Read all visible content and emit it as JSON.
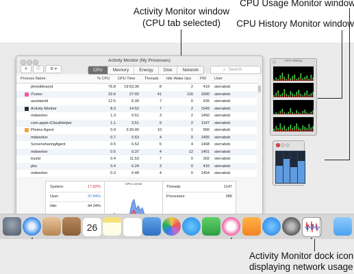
{
  "callouts": {
    "activity_window": "Activity Monitor window\n(CPU tab selected)",
    "cpu_usage": "CPU Usage Monitor window",
    "cpu_history": "CPU History Monitor window",
    "dock_icon": "Activity Monitor dock icon\ndisplaying network usage"
  },
  "window": {
    "title": "Activity Monitor (My Processes)",
    "tabs": [
      "CPU",
      "Memory",
      "Energy",
      "Disk",
      "Network"
    ],
    "active_tab": "CPU",
    "search_placeholder": "Search",
    "columns": [
      "Process Name",
      "% CPU",
      "CPU Time",
      "Threads",
      "Idle Wake Ups",
      "PID",
      "User"
    ],
    "processes": [
      {
        "name": "photolibraryd",
        "cpu": "76.8",
        "time": "19:53.36",
        "threads": "8",
        "idle": "2",
        "pid": "419",
        "user": "sierrabob",
        "icon": ""
      },
      {
        "name": "iTunes",
        "cpu": "32.6",
        "time": "27:02",
        "threads": "41",
        "idle": "116",
        "pid": "1600",
        "user": "sierrabob",
        "icon": "itunes-icon"
      },
      {
        "name": "assistantd",
        "cpu": "12.5",
        "time": "6.39",
        "threads": "7",
        "idle": "0",
        "pid": "426",
        "user": "sierrabob",
        "icon": ""
      },
      {
        "name": "Activity Monitor",
        "cpu": "8.3",
        "time": "14.52",
        "threads": "7",
        "idle": "2",
        "pid": "1549",
        "user": "sierrabob",
        "icon": "activity-monitor-icon"
      },
      {
        "name": "mdworker",
        "cpu": "1.3",
        "time": "0.51",
        "threads": "3",
        "idle": "2",
        "pid": "1450",
        "user": "sierrabob",
        "icon": ""
      },
      {
        "name": "com.apple.iCloudHelper",
        "cpu": "1.1",
        "time": "3.51",
        "threads": "9",
        "idle": "2",
        "pid": "1147",
        "user": "sierrabob",
        "icon": ""
      },
      {
        "name": "Photos Agent",
        "cpu": "0.9",
        "time": "2:20.40",
        "threads": "10",
        "idle": "1",
        "pid": "566",
        "user": "sierrabob",
        "icon": "photos-icon"
      },
      {
        "name": "mdworker",
        "cpu": "0.7",
        "time": "0.63",
        "threads": "4",
        "idle": "0",
        "pid": "1455",
        "user": "sierrabob",
        "icon": ""
      },
      {
        "name": "ScreensharingAgent",
        "cpu": "0.5",
        "time": "6.52",
        "threads": "5",
        "idle": "4",
        "pid": "1468",
        "user": "sierrabob",
        "icon": ""
      },
      {
        "name": "mdworker",
        "cpu": "0.5",
        "time": "0.37",
        "threads": "4",
        "idle": "12",
        "pid": "1451",
        "user": "sierrabob",
        "icon": ""
      },
      {
        "name": "trustd",
        "cpu": "0.4",
        "time": "11.53",
        "threads": "7",
        "idle": "0",
        "pid": "302",
        "user": "sierrabob",
        "icon": ""
      },
      {
        "name": "pbs",
        "cpu": "0.4",
        "time": "0.24",
        "threads": "3",
        "idle": "0",
        "pid": "416",
        "user": "sierrabob",
        "icon": ""
      },
      {
        "name": "mdworker",
        "cpu": "0.3",
        "time": "0.48",
        "threads": "4",
        "idle": "0",
        "pid": "1454",
        "user": "sierrabob",
        "icon": ""
      },
      {
        "name": "nsurlstoraged",
        "cpu": "0.3",
        "time": "2.19",
        "threads": "3",
        "idle": "0",
        "pid": "422",
        "user": "sierrabob",
        "icon": ""
      },
      {
        "name": "com.apple.iTunes.libraryServ...",
        "cpu": "0.3",
        "time": "0.25",
        "threads": "4",
        "idle": "0",
        "pid": "430",
        "user": "sierrabob",
        "icon": ""
      }
    ],
    "stats": {
      "system_label": "System:",
      "system_value": "17.82%",
      "user_label": "User:",
      "user_value": "37.84%",
      "idle_label": "Idle:",
      "idle_value": "44.34%",
      "cpu_load_label": "CPU LOAD",
      "threads_label": "Threads",
      "threads_value": "1147",
      "processes_label": "Processes:",
      "processes_value": "286"
    }
  },
  "history": {
    "title": "CPU History"
  },
  "usage_levels": [
    0.55,
    0.75,
    0.5,
    0.7
  ],
  "colors": {
    "system": "#d0303a",
    "user": "#3a6fd0",
    "accent": "#6f6f6f"
  }
}
